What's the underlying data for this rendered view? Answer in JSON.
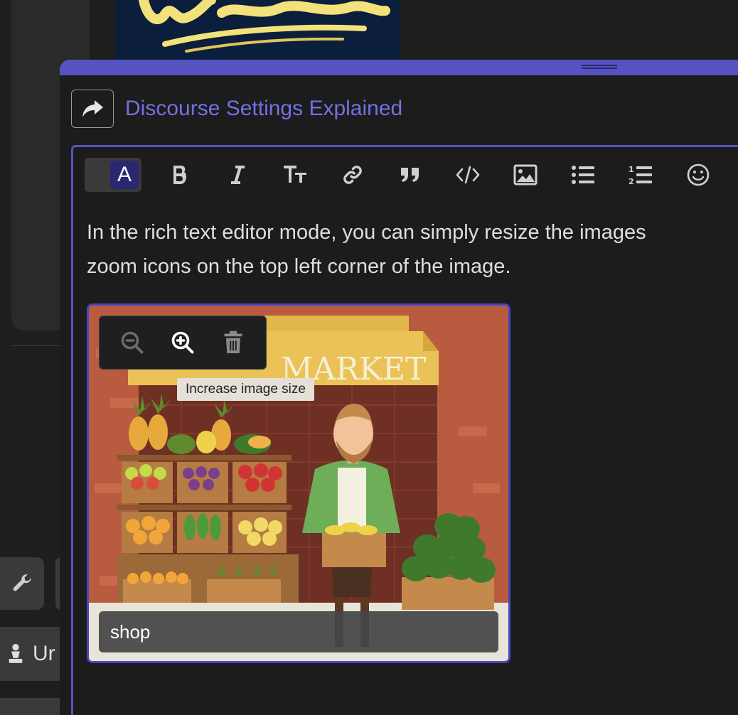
{
  "background": {
    "unread_label": "Ur"
  },
  "composer": {
    "topic_title": "Discourse Settings Explained",
    "mode_toggle_letter": "A",
    "toolbar": [
      {
        "name": "bold-button",
        "icon": "bold-icon"
      },
      {
        "name": "italic-button",
        "icon": "italic-icon"
      },
      {
        "name": "heading-button",
        "icon": "heading-icon"
      },
      {
        "name": "link-button",
        "icon": "link-icon"
      },
      {
        "name": "quote-button",
        "icon": "quote-icon"
      },
      {
        "name": "code-button",
        "icon": "code-icon"
      },
      {
        "name": "image-button",
        "icon": "image-icon"
      },
      {
        "name": "bullet-list-button",
        "icon": "bullet-list-icon"
      },
      {
        "name": "numbered-list-button",
        "icon": "numbered-list-icon"
      },
      {
        "name": "emoji-button",
        "icon": "emoji-icon"
      }
    ],
    "body_line1": "In the rich text editor mode, you can simply resize the images",
    "body_line2": "zoom icons on the top left corner of the image.",
    "image": {
      "sign_text": "MARKET",
      "tooltip": "Increase image size",
      "alt_text": "shop"
    }
  },
  "colors": {
    "accent": "#5652c2",
    "title": "#7470e4"
  }
}
